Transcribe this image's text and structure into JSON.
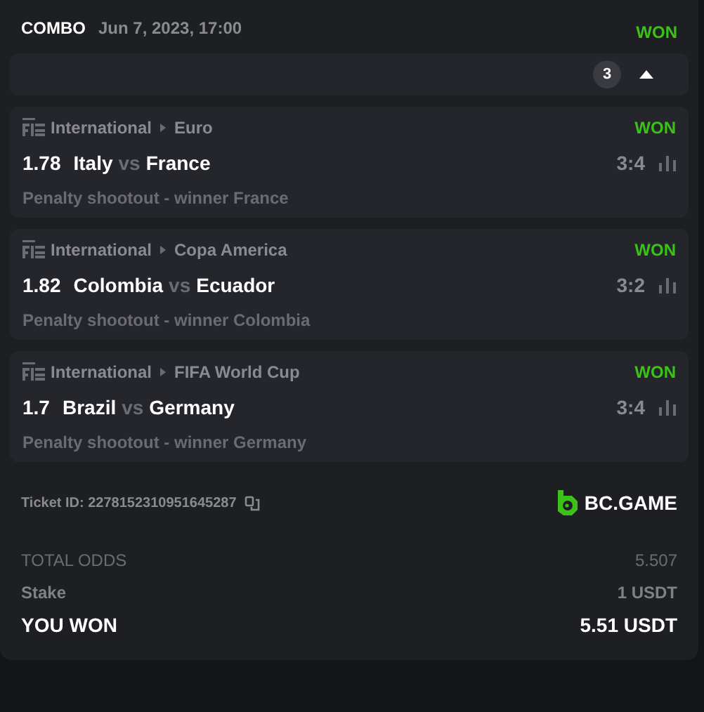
{
  "header": {
    "type": "COMBO",
    "date": "Jun 7, 2023, 17:00",
    "status": "WON"
  },
  "selections_bar": {
    "count": "3",
    "expanded": true
  },
  "selections": [
    {
      "category": "International",
      "league": "Euro",
      "status": "WON",
      "odds": "1.78",
      "home": "Italy",
      "vs": "vs",
      "away": "France",
      "score": "3:4",
      "market": "Penalty shootout - winner France"
    },
    {
      "category": "International",
      "league": "Copa America",
      "status": "WON",
      "odds": "1.82",
      "home": "Colombia",
      "vs": "vs",
      "away": "Ecuador",
      "score": "3:2",
      "market": "Penalty shootout - winner Colombia"
    },
    {
      "category": "International",
      "league": "FIFA World Cup",
      "status": "WON",
      "odds": "1.7",
      "home": "Brazil",
      "vs": "vs",
      "away": "Germany",
      "score": "3:4",
      "market": "Penalty shootout - winner Germany"
    }
  ],
  "ticket": {
    "label": "Ticket ID:",
    "id": "2278152310951645287",
    "brand": "BC.GAME"
  },
  "summary": [
    {
      "kind": "muted",
      "label": "TOTAL ODDS",
      "value": "5.507"
    },
    {
      "kind": "normal",
      "label": "Stake",
      "value": "1 USDT"
    },
    {
      "kind": "highlight",
      "label": "YOU WON",
      "value": "5.51 USDT"
    }
  ]
}
